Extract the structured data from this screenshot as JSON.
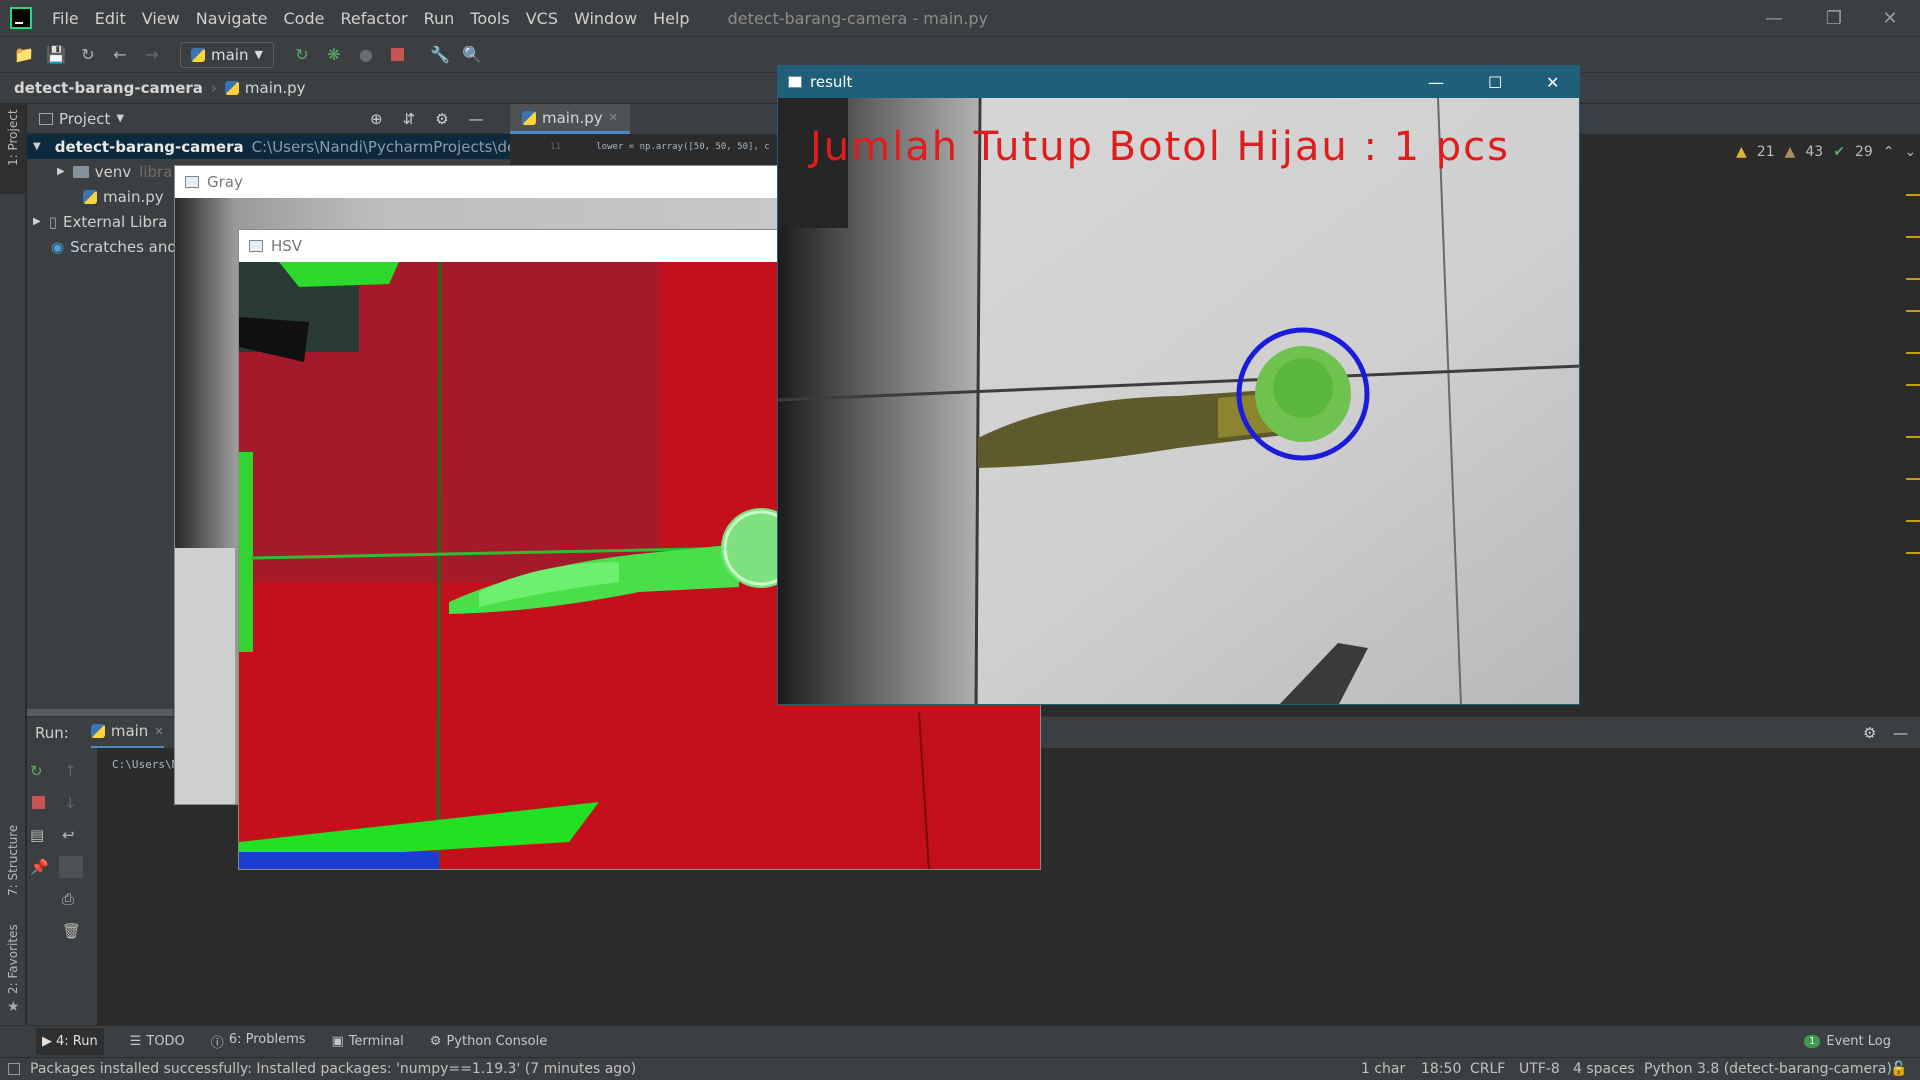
{
  "menubar": {
    "items": [
      "File",
      "Edit",
      "View",
      "Navigate",
      "Code",
      "Refactor",
      "Run",
      "Tools",
      "VCS",
      "Window",
      "Help"
    ],
    "title": "detect-barang-camera - main.py"
  },
  "toolbar": {
    "run_config": "main"
  },
  "navbar": {
    "project": "detect-barang-camera",
    "file": "main.py"
  },
  "sidebar_left": {
    "project_label": "1: Project",
    "structure_label": "7: Structure",
    "favorites_label": "2: Favorites"
  },
  "project_panel": {
    "title": "Project",
    "rows": [
      {
        "label": "detect-barang-camera",
        "path": "C:\\Users\\Nandi\\PycharmProjects\\detec"
      },
      {
        "label": "venv",
        "suffix": "libra"
      },
      {
        "label": "main.py"
      },
      {
        "label": "External Libra"
      },
      {
        "label": "Scratches and"
      }
    ]
  },
  "editor": {
    "tab": "main.py",
    "code_line_no": "11",
    "code_line": "lower = np.array([50, 50, 50], c",
    "inspections": {
      "warnings": "21",
      "weak_warnings": "43",
      "ok": "29"
    }
  },
  "run_panel": {
    "label": "Run:",
    "tab": "main",
    "console": "C:\\Users\\N"
  },
  "windows": {
    "gray": {
      "title": "Gray"
    },
    "hsv": {
      "title": "HSV"
    },
    "result": {
      "title": "result",
      "overlay_text": "Jumlah Tutup Botol Hijau : 1 pcs"
    }
  },
  "bottom_tabs": [
    "4: Run",
    "TODO",
    "6: Problems",
    "Terminal",
    "Python Console"
  ],
  "event_log": {
    "count": "1",
    "label": "Event Log"
  },
  "statusbar": {
    "message": "Packages installed successfully: Installed packages: 'numpy==1.19.3' (7 minutes ago)",
    "chars": "1 char",
    "position": "18:50",
    "line_sep": "CRLF",
    "encoding": "UTF-8",
    "indent": "4 spaces",
    "interpreter": "Python 3.8 (detect-barang-camera)"
  },
  "colors": {
    "accent": "#4a88c7",
    "result_text": "#e11c1c",
    "circle": "#1b1bdc"
  }
}
